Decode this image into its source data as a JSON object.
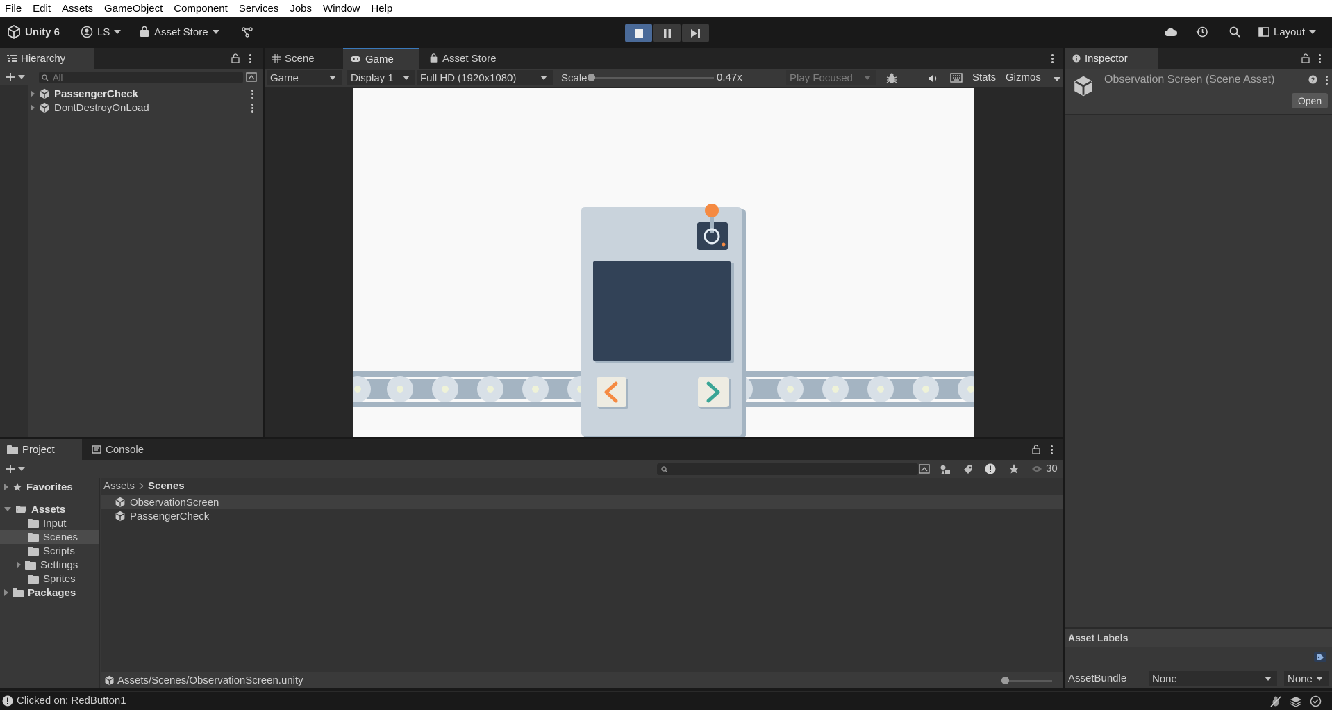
{
  "menu": [
    "File",
    "Edit",
    "Assets",
    "GameObject",
    "Component",
    "Services",
    "Jobs",
    "Window",
    "Help"
  ],
  "toolbar": {
    "unity_label": "Unity 6",
    "account_label": "LS",
    "asset_store_label": "Asset Store",
    "layout_label": "Layout"
  },
  "hierarchy": {
    "tab_label": "Hierarchy",
    "search_placeholder": "All",
    "items": [
      {
        "label": "PassengerCheck"
      },
      {
        "label": "DontDestroyOnLoad"
      }
    ]
  },
  "center_tabs": [
    "Scene",
    "Game",
    "Asset Store"
  ],
  "game_toolbar": {
    "mode": "Game",
    "display": "Display 1",
    "resolution": "Full HD (1920x1080)",
    "scale_label": "Scale",
    "scale_value": "0.47x",
    "play_mode": "Play Focused",
    "stats": "Stats",
    "gizmos": "Gizmos"
  },
  "inspector": {
    "tab_label": "Inspector",
    "title": "Observation Screen (Scene Asset)",
    "open_button": "Open",
    "asset_labels": "Asset Labels",
    "assetbundle_label": "AssetBundle",
    "assetbundle_value": "None",
    "variant_value": "None"
  },
  "bottom_tabs": [
    "Project",
    "Console"
  ],
  "project": {
    "visible_count": "30",
    "breadcrumb": [
      "Assets",
      "Scenes"
    ],
    "tree": {
      "favorites": "Favorites",
      "assets": "Assets",
      "children": [
        "Input",
        "Scenes",
        "Scripts",
        "Settings",
        "Sprites"
      ],
      "packages": "Packages"
    },
    "files": [
      "ObservationScreen",
      "PassengerCheck"
    ],
    "selected_path": "Assets/Scenes/ObservationScreen.unity"
  },
  "status_bar": {
    "message": "Clicked on: RedButton1"
  },
  "colors": {
    "accent_blue": "#3a79bb",
    "game_bg": "#f9f9f9",
    "machine_body": "#c9d3dc",
    "machine_screen": "#324257",
    "conveyor": "#a4b4c2",
    "orange": "#f58a42",
    "teal": "#3aa596"
  }
}
